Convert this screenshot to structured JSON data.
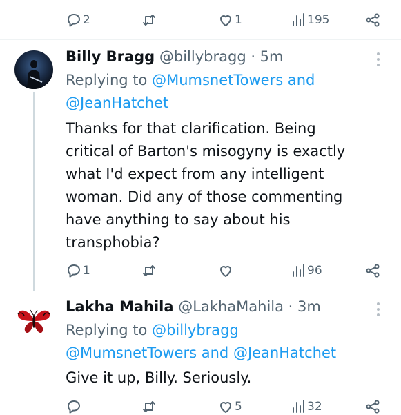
{
  "tweet0": {
    "actions": {
      "replies": "2",
      "retweets": "",
      "likes": "1",
      "views": "195"
    }
  },
  "tweet1": {
    "display_name": "Billy Bragg",
    "handle_time": "@billybragg · 5m",
    "replying_prefix": "Replying to ",
    "replying_line1_link": "@MumsnetTowers",
    "replying_and": " and",
    "replying_line2_link": "@JeanHatchet",
    "body_lines": [
      "Thanks for that clarification. Being",
      "critical of Barton's misogyny is exactly",
      "what I'd expect from any intelligent",
      "woman. Did any of those commenting",
      "have anything to say about his",
      "transphobia?"
    ],
    "actions": {
      "replies": "1",
      "retweets": "",
      "likes": "",
      "views": "96"
    },
    "avatar": "concert-photo"
  },
  "tweet2": {
    "display_name": "Lakha Mahila",
    "handle_time": "@LakhaMahila · 3m",
    "replying_prefix": "Replying to ",
    "replying_line1_link": "@billybragg",
    "replying_line2_link_a": "@MumsnetTowers",
    "replying_and": " and ",
    "replying_line2_link_b": "@JeanHatchet",
    "body_lines": [
      "Give it up, Billy. Seriously."
    ],
    "actions": {
      "replies": "",
      "retweets": "",
      "likes": "5",
      "views": "32"
    },
    "avatar": "red-butterfly"
  },
  "colors": {
    "link": "#1d9bf0",
    "muted": "#536471",
    "text": "#0f1419",
    "thread_line": "#cfd9de"
  },
  "icons": [
    "reply-icon",
    "retweet-icon",
    "like-icon",
    "views-icon",
    "share-icon",
    "more-icon"
  ]
}
